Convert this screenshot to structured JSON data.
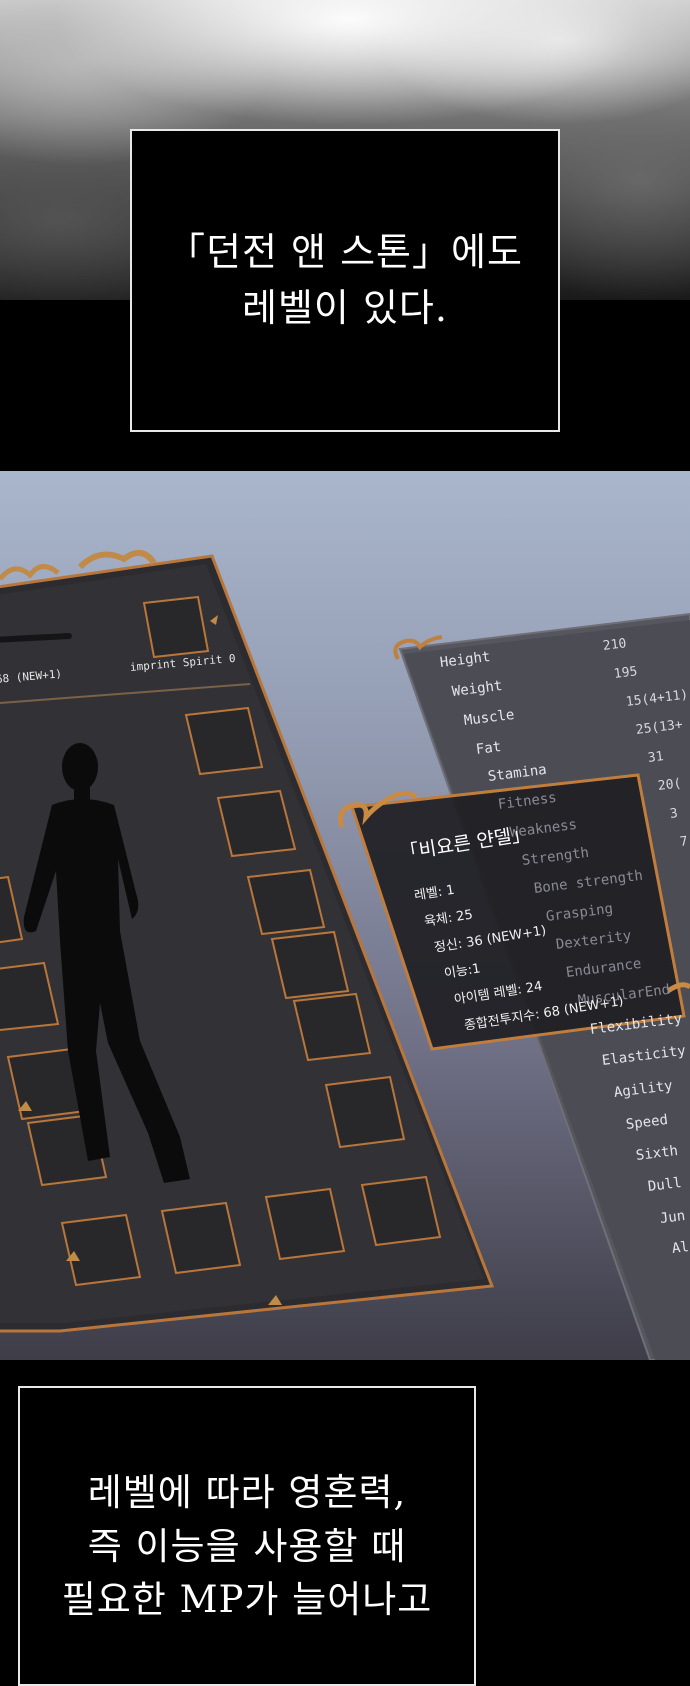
{
  "caption_top": {
    "lines": [
      "「던전 앤 스톤」에도",
      "레벨이 있다."
    ]
  },
  "equipment_window": {
    "spirit_partial": "68 (NEW+1)",
    "imprint": "imprint Spirit 0"
  },
  "stats_window": {
    "labels": [
      "Height",
      "Weight",
      "Muscle",
      "Fat",
      "Stamina",
      "Fitness",
      "Weakness",
      "Strength",
      "Bone strength",
      "Grasping",
      "Dexterity",
      "Endurance",
      "MuscularEnd",
      "Flexibility",
      "Elasticity",
      "Agility",
      "Speed",
      "Sixth",
      "Dull",
      "Jun",
      "Al"
    ],
    "values": [
      "210",
      "195",
      "15(4+11)",
      "25(13+",
      "31",
      "20(",
      "3",
      "7"
    ]
  },
  "character_card": {
    "title": "「비요른 얀델」",
    "lines": [
      "레벨: 1",
      "육체: 25",
      "정신: 36 (NEW+1)",
      "이능:1",
      "아이템 레벨: 24",
      "종합전투지수: 68 (NEW+1)"
    ]
  },
  "caption_bottom": {
    "lines": [
      "레벨에 따라 영혼력,",
      "즉 이능을 사용할 때",
      "필요한 MP가 늘어나고"
    ]
  },
  "colors": {
    "frame_bronze": "#b9763a",
    "panel_dark": "#2a2a2e",
    "sky_top": "#a9b6cc"
  }
}
